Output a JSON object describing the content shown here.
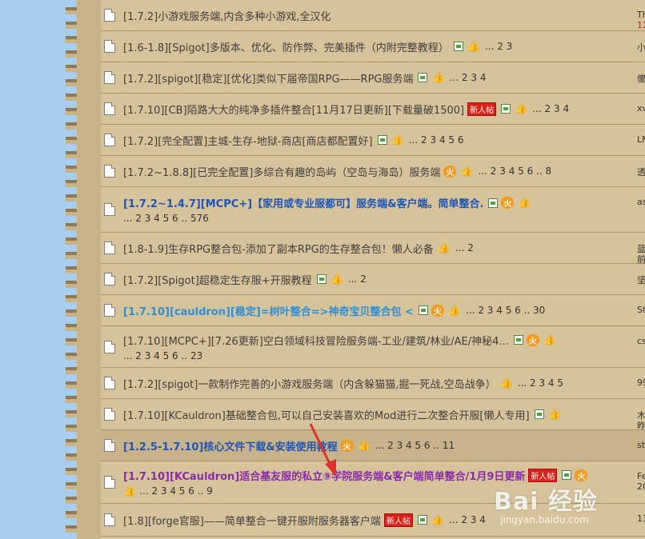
{
  "rows": [
    {
      "title": "[1.7.2]小游戏服务端,内含多种小游戏,全汉化",
      "color": "normal",
      "icons": [],
      "pages": "",
      "line2": "",
      "right1": "Th",
      "right2": "12",
      "right2red": true,
      "h": 39
    },
    {
      "title": "[1.6-1.8][Spigot]多版本、优化、防作弊、完美插件（内附完整教程）",
      "color": "normal",
      "icons": [
        "img",
        "thumb"
      ],
      "pages": "... 2  3",
      "line2": "",
      "right1": "小",
      "right2": "",
      "h": 39
    },
    {
      "title": "[1.7.2][spigot][稳定][优化]类似下届帝国RPG——RPG服务端",
      "color": "normal",
      "icons": [
        "img",
        "thumb"
      ],
      "pages": "... 2  3  4",
      "line2": "",
      "right1": "傻",
      "right2": "",
      "h": 39
    },
    {
      "title": "[1.7.10][CB]陌路大大的纯净多插件整合[11月17日更新][下载量破1500]",
      "color": "normal",
      "icons": [
        "new",
        "img",
        "thumb"
      ],
      "pages": "... 2  3  4",
      "line2": "",
      "right1": "xv",
      "right2": "",
      "h": 39
    },
    {
      "title": "[1.7.2][完全配置]主城-生存-地狱-商店[商店都配置好]",
      "color": "normal",
      "icons": [
        "img",
        "thumb"
      ],
      "pages": "... 2  3  4  5  6",
      "line2": "",
      "right1": "LN",
      "right2": "",
      "h": 39
    },
    {
      "title": "[1.7.2~1.8.8][已完全配置]多综合有趣的岛屿（空岛与海岛）服务端",
      "color": "normal",
      "icons": [
        "hot",
        "thumb"
      ],
      "pages": "... 2  3  4  5  6 .. 8",
      "line2": "",
      "right1": "透",
      "right2": "",
      "h": 39
    },
    {
      "title": "[1.7.2~1.4.7][MCPC+]【家用或专业服都可】服务端&客户端。简单整合.",
      "color": "dblue",
      "icons": [
        "img",
        "hot",
        "thumb"
      ],
      "pages": "",
      "line2": "... 2  3  4  5  6 .. 576",
      "right1": "as",
      "right2": "",
      "h": 57
    },
    {
      "title": "[1.8-1.9]生存RPG整合包-添加了副本RPG的生存整合包！懒人必备",
      "color": "normal",
      "icons": [
        "thumb"
      ],
      "pages": "... 2",
      "line2": "",
      "right1": "蓝",
      "right2": "前",
      "h": 39
    },
    {
      "title": "[1.7.2][Spigot]超稳定生存服+开服教程",
      "color": "normal",
      "icons": [
        "img",
        "thumb"
      ],
      "pages": "... 2",
      "line2": "",
      "right1": "坚",
      "right2": "",
      "h": 39
    },
    {
      "title": "[1.7.10][cauldron][稳定]=树叶整合=>神奇宝贝整合包 <",
      "color": "cyan",
      "icons": [
        "img",
        "hot",
        "thumb"
      ],
      "pages": "... 2  3  4  5  6 .. 30",
      "line2": "",
      "right1": "St",
      "right2": "",
      "h": 39
    },
    {
      "title": "[1.7.10][MCPC+][7.26更新]空白领域科技冒险服务端-工业/建筑/林业/AE/神秘4...",
      "color": "normal",
      "icons": [
        "img",
        "hot",
        "thumb"
      ],
      "pages": "",
      "line2": "... 2  3  4  5  6 .. 23",
      "right1": "cs",
      "right2": "",
      "h": 52
    },
    {
      "title": "[1.7.2][spigot]一款制作完善的小游戏服务端（内含躲猫猫,掘一死战,空岛战争）",
      "color": "normal",
      "icons": [
        "thumb"
      ],
      "pages": "... 2  3  4  5",
      "line2": "",
      "right1": "99",
      "right2": "",
      "h": 39
    },
    {
      "title": "[1.7.10][KCauldron]基础整合包,可以自己安装喜欢的Mod进行二次整合开服[懒人专用]",
      "color": "normal",
      "icons": [
        "img",
        "thumb"
      ],
      "pages": "",
      "line2": "",
      "right1": "木",
      "right2": "昨",
      "h": 39
    },
    {
      "title": "[1.2.5-1.7.10]核心文件下载&安装使用教程",
      "color": "dblue",
      "icons": [
        "hot",
        "thumb"
      ],
      "pages": "... 2  3  4  5  6 .. 11",
      "line2": "",
      "right1": "st",
      "right2": "",
      "h": 39,
      "hl": true
    },
    {
      "title": "[1.7.10][KCauldron]适合基友服的私立⑨学院服务端&客户端简单整合/1月9日更新",
      "color": "purple",
      "icons": [
        "new",
        "img",
        "hot"
      ],
      "pages": "",
      "line2": "... 2  3  4  5  6 .. 9",
      "right1": "Fe",
      "right2": "20",
      "h": 53
    },
    {
      "title": "[1.8][forge官服]——简单整合一键开服附服务器客户端",
      "color": "normal",
      "icons": [
        "new",
        "img",
        "thumb"
      ],
      "pages": "... 2  3  4",
      "line2": "",
      "right1": "13",
      "right2": "",
      "h": 41
    }
  ],
  "badges": {
    "new": "新人帖",
    "hot": "火"
  },
  "watermark": {
    "logo": "Bai 经验",
    "url": "jingyan.baidu.com"
  },
  "colors": {
    "sidebar": "#a7cdf0",
    "panel": "#d6c39a",
    "new_badge": "#d8221a",
    "hot_badge": "#f29b1f",
    "thumb": "#e8a437"
  },
  "icon_names": {
    "img": "image-attachment-icon",
    "thumb": "thumbs-up-icon",
    "new": "new-post-badge",
    "hot": "hot-topic-icon",
    "doc": "thread-document-icon"
  }
}
